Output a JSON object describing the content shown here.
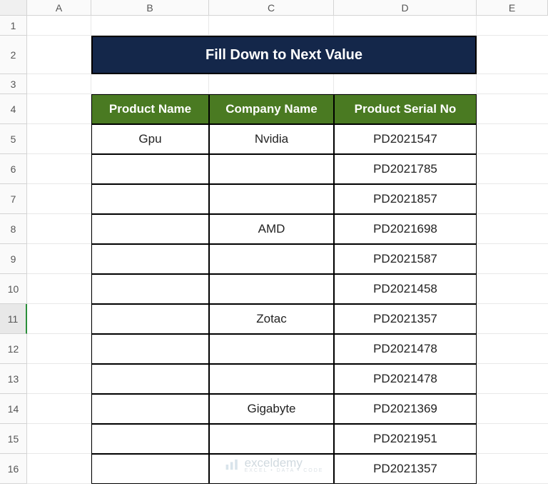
{
  "columns": [
    "A",
    "B",
    "C",
    "D",
    "E"
  ],
  "rows": [
    "1",
    "2",
    "3",
    "4",
    "5",
    "6",
    "7",
    "8",
    "9",
    "10",
    "11",
    "12",
    "13",
    "14",
    "15",
    "16"
  ],
  "selected_row": "11",
  "title": "Fill Down to Next Value",
  "headers": {
    "product_name": "Product Name",
    "company_name": "Company  Name",
    "product_serial": "Product Serial No"
  },
  "chart_data": {
    "type": "table",
    "columns": [
      "Product Name",
      "Company  Name",
      "Product Serial No"
    ],
    "rows": [
      {
        "product": "Gpu",
        "company": "Nvidia",
        "serial": "PD2021547"
      },
      {
        "product": "",
        "company": "",
        "serial": "PD2021785"
      },
      {
        "product": "",
        "company": "",
        "serial": "PD2021857"
      },
      {
        "product": "",
        "company": "AMD",
        "serial": "PD2021698"
      },
      {
        "product": "",
        "company": "",
        "serial": "PD2021587"
      },
      {
        "product": "",
        "company": "",
        "serial": "PD2021458"
      },
      {
        "product": "",
        "company": "Zotac",
        "serial": "PD2021357"
      },
      {
        "product": "",
        "company": "",
        "serial": "PD2021478"
      },
      {
        "product": "",
        "company": "",
        "serial": "PD2021478"
      },
      {
        "product": "",
        "company": "Gigabyte",
        "serial": "PD2021369"
      },
      {
        "product": "",
        "company": "",
        "serial": "PD2021951"
      },
      {
        "product": "",
        "company": "",
        "serial": "PD2021357"
      }
    ]
  },
  "watermark": {
    "name": "exceldemy",
    "sub": "EXCEL • DATA • CODE"
  }
}
